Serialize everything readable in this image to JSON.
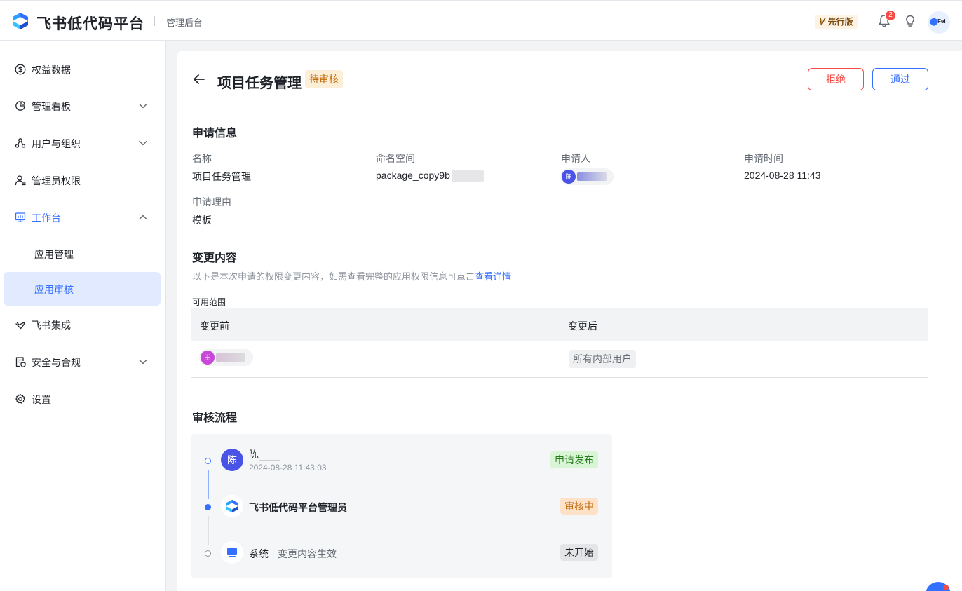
{
  "header": {
    "brand": "飞书低代码平台",
    "subtitle": "管理后台",
    "edition_badge": "先行版",
    "edition_mark": "V",
    "notification_count": "2",
    "avatar_text": "Fei"
  },
  "sidebar": {
    "items": [
      {
        "label": "权益数据",
        "icon": "dollar-circle-icon"
      },
      {
        "label": "管理看板",
        "icon": "pie-chart-icon"
      },
      {
        "label": "用户与组织",
        "icon": "org-tree-icon"
      },
      {
        "label": "管理员权限",
        "icon": "admin-user-icon"
      },
      {
        "label": "工作台",
        "icon": "monitor-icon"
      },
      {
        "label": "飞书集成",
        "icon": "integration-icon"
      },
      {
        "label": "安全与合规",
        "icon": "shield-doc-icon"
      },
      {
        "label": "设置",
        "icon": "gear-icon"
      }
    ],
    "sub_items": [
      {
        "label": "应用管理"
      },
      {
        "label": "应用审核"
      }
    ]
  },
  "page": {
    "title": "项目任务管理",
    "status": "待审核",
    "reject_label": "拒绝",
    "approve_label": "通过"
  },
  "request_info": {
    "section_title": "申请信息",
    "name_label": "名称",
    "name_value": "项目任务管理",
    "namespace_label": "命名空间",
    "namespace_value": "package_copy9b",
    "applicant_label": "申请人",
    "applicant_avatar": "陈",
    "time_label": "申请时间",
    "time_value": "2024-08-28 11:43",
    "reason_label": "申请理由",
    "reason_value": "模板"
  },
  "changes": {
    "section_title": "变更内容",
    "description": "以下是本次申请的权限变更内容，如需查看完整的应用权限信息可点击",
    "details_link": "查看详情",
    "scope_label": "可用范围",
    "col_before": "变更前",
    "col_after": "变更后",
    "before_avatar": "王",
    "after_value": "所有内部用户"
  },
  "workflow": {
    "section_title": "审核流程",
    "steps": [
      {
        "avatar": "陈",
        "name": "陈",
        "time": "2024-08-28 11:43:03",
        "status": "申请发布"
      },
      {
        "name": "飞书低代码平台管理员",
        "status": "审核中"
      },
      {
        "name": "系统",
        "detail": "变更内容生效",
        "status": "未开始"
      }
    ]
  },
  "colors": {
    "primary": "#3370ff",
    "danger": "#f54a45",
    "pending_bg": "#fdeed7",
    "pending_text": "#c06b0b",
    "success_bg": "#d9f5d6",
    "success_text": "#237b19"
  }
}
